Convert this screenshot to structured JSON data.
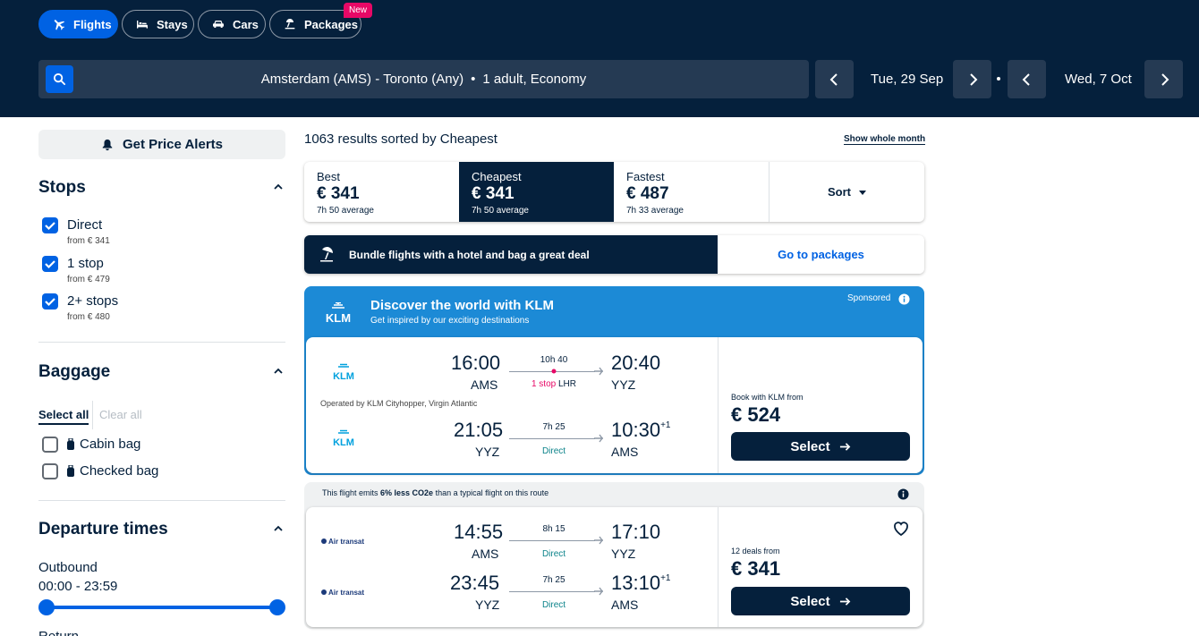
{
  "tabs": [
    {
      "label": "Flights",
      "icon": "plane-icon",
      "active": true
    },
    {
      "label": "Stays",
      "icon": "bed-icon",
      "active": false
    },
    {
      "label": "Cars",
      "icon": "car-icon",
      "active": false
    },
    {
      "label": "Packages",
      "icon": "package-icon",
      "active": false
    }
  ],
  "new_badge": "New",
  "search": {
    "route": "Amsterdam (AMS) - Toronto (Any)",
    "separator": "•",
    "travellers": "1 adult, Economy"
  },
  "dates": {
    "depart": "Tue, 29 Sep",
    "return": "Wed, 7 Oct"
  },
  "sidebar": {
    "price_alerts": "Get Price Alerts",
    "stops": {
      "title": "Stops",
      "options": [
        {
          "label": "Direct",
          "sub": "from € 341",
          "checked": true
        },
        {
          "label": "1 stop",
          "sub": "from € 479",
          "checked": true
        },
        {
          "label": "2+ stops",
          "sub": "from € 480",
          "checked": true
        }
      ]
    },
    "baggage": {
      "title": "Baggage",
      "select_all": "Select all",
      "clear_all": "Clear all",
      "options": [
        {
          "label": "Cabin bag",
          "checked": false
        },
        {
          "label": "Checked bag",
          "checked": false
        }
      ]
    },
    "departure": {
      "title": "Departure times",
      "outbound_label": "Outbound",
      "outbound_range": "00:00 - 23:59",
      "return_label": "Return"
    }
  },
  "results": {
    "count": "1063 results sorted by Cheapest",
    "show_month": "Show whole month",
    "sort_tabs": [
      {
        "label": "Best",
        "price": "€ 341",
        "dur": "7h 50 average",
        "active": false
      },
      {
        "label": "Cheapest",
        "price": "€ 341",
        "dur": "7h 50 average",
        "active": true
      },
      {
        "label": "Fastest",
        "price": "€ 487",
        "dur": "7h 33 average",
        "active": false
      }
    ],
    "sort_label": "Sort",
    "bundle_text": "Bundle flights with a hotel and bag a great deal",
    "bundle_cta": "Go to packages"
  },
  "sponsored": {
    "title": "Discover the world with KLM",
    "subtitle": "Get inspired by our exciting destinations",
    "sponsored_label": "Sponsored",
    "logo_text": "KLM",
    "legs": [
      {
        "dep": "16:00",
        "dep_code": "AMS",
        "dur": "10h 40",
        "stops": "1 stop",
        "stop_code": "LHR",
        "arr": "20:40",
        "arr_code": "YYZ",
        "plus": ""
      },
      {
        "dep": "21:05",
        "dep_code": "YYZ",
        "dur": "7h 25",
        "stops": "Direct",
        "stop_code": "",
        "arr": "10:30",
        "arr_code": "AMS",
        "plus": "+1"
      }
    ],
    "operated": "Operated by KLM Cityhopper, Virgin Atlantic",
    "price_sub": "Book with KLM from",
    "price": "€ 524",
    "select": "Select"
  },
  "flight2": {
    "eco_prefix": "This flight emits ",
    "eco_bold": "6% less CO2e",
    "eco_suffix": " than a typical flight on this route",
    "logo_text": "Air transat",
    "legs": [
      {
        "dep": "14:55",
        "dep_code": "AMS",
        "dur": "8h 15",
        "stops": "Direct",
        "arr": "17:10",
        "arr_code": "YYZ",
        "plus": ""
      },
      {
        "dep": "23:45",
        "dep_code": "YYZ",
        "dur": "7h 25",
        "stops": "Direct",
        "arr": "13:10",
        "arr_code": "AMS",
        "plus": "+1"
      }
    ],
    "price_sub": "12 deals from",
    "price": "€ 341",
    "select": "Select"
  },
  "colors": {
    "navy": "#05203c",
    "blue": "#0062e3",
    "klm_blue": "#1c8ad6",
    "stop_red": "#e70866",
    "direct_teal": "#0c838a"
  }
}
